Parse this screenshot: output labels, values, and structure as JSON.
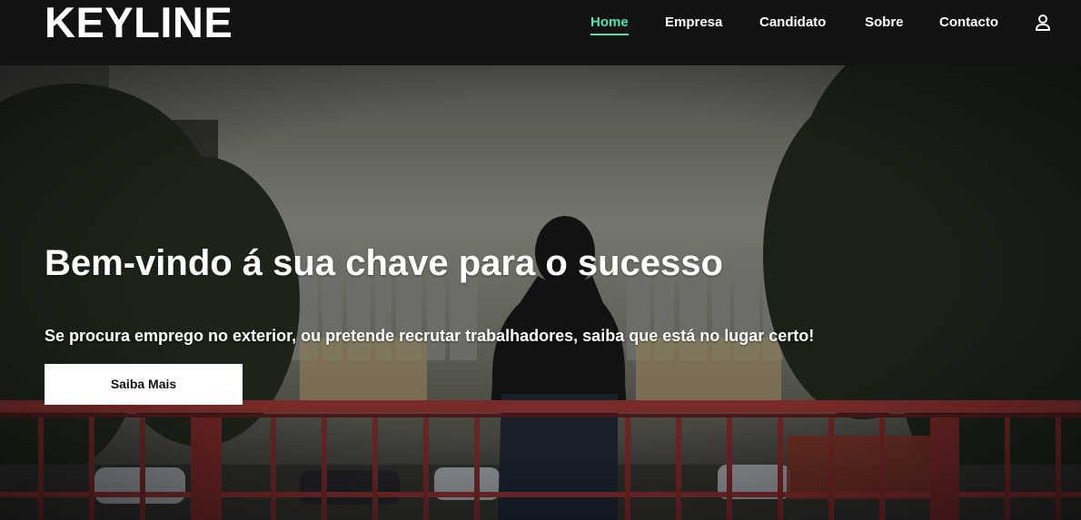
{
  "brand": {
    "name": "KEYLINE"
  },
  "nav": {
    "items": [
      {
        "label": "Home",
        "active": true
      },
      {
        "label": "Empresa",
        "active": false
      },
      {
        "label": "Candidato",
        "active": false
      },
      {
        "label": "Sobre",
        "active": false
      },
      {
        "label": "Contacto",
        "active": false
      }
    ],
    "account_icon": "user-icon"
  },
  "hero": {
    "title": "Bem-vindo á sua chave para o sucesso",
    "subtitle": "Se procura emprego no exterior, ou pretende recrutar trabalhadores, saiba que está no lugar certo!",
    "cta_label": "Saiba Mais"
  },
  "colors": {
    "navbar_bg": "#121212",
    "accent": "#4fe3b6",
    "text": "#ffffff",
    "railing": "#7a2a2a"
  }
}
